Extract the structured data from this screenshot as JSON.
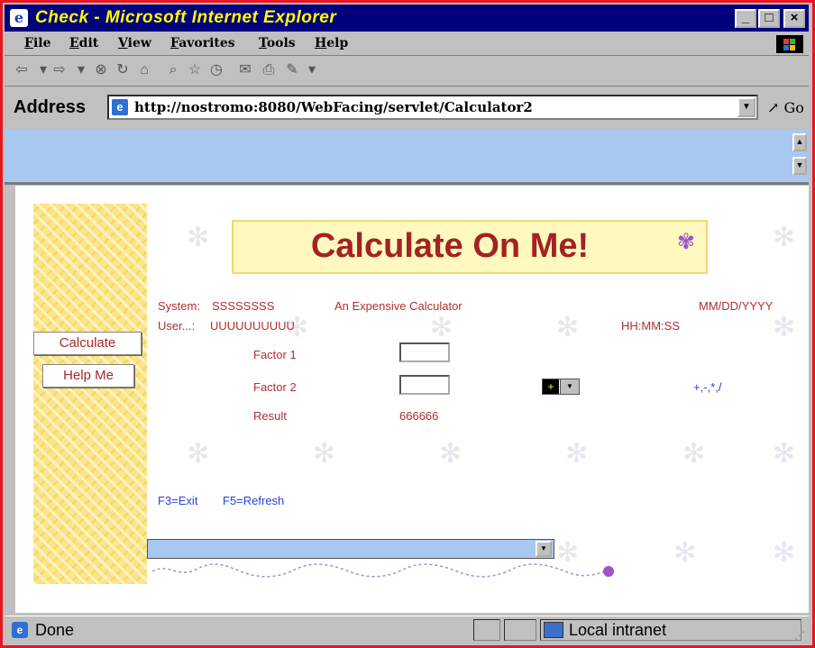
{
  "window": {
    "title": "Check - Microsoft Internet Explorer",
    "icon": "ie-icon",
    "buttons": {
      "minimize": "_",
      "maximize": "□",
      "close": "×"
    }
  },
  "menu": {
    "items": [
      "File",
      "Edit",
      "View",
      "Favorites",
      "Tools",
      "Help"
    ]
  },
  "toolbar": {
    "icons": [
      "back-icon",
      "forward-icon",
      "stop-icon",
      "refresh-icon",
      "home-icon",
      "search-icon",
      "favorites-icon",
      "history-icon",
      "mail-icon",
      "print-icon",
      "edit-icon"
    ]
  },
  "address": {
    "label": "Address",
    "url": "http://nostromo:8080/WebFacing/servlet/Calculator2",
    "go": "Go"
  },
  "sidebar": {
    "calculate": "Calculate",
    "help": "Help Me"
  },
  "banner": {
    "title": "Calculate On Me!"
  },
  "form": {
    "system_label": "System:",
    "system_value": "SSSSSSSS",
    "description": "An Expensive Calculator",
    "date_format": "MM/DD/YYYY",
    "user_label": "User...:",
    "user_value": "UUUUUUUUUU",
    "time_format": "HH:MM:SS",
    "factor1_label": "Factor 1",
    "factor1_value": "",
    "factor2_label": "Factor 2",
    "factor2_value": "",
    "operator_value": "+",
    "operators_hint": "+,-,*,/",
    "result_label": "Result",
    "result_value": "666666"
  },
  "function_keys": {
    "f3": "F3=Exit",
    "f5": "F5=Refresh"
  },
  "status": {
    "text": "Done",
    "zone": "Local intranet"
  },
  "colors": {
    "title_bar": "#00007c",
    "title_text": "#ffff00",
    "frame_border": "#e8141e",
    "top_frame": "#a8c8f0",
    "banner_text": "#a42222",
    "label_text": "#b03030",
    "link_text": "#2a3fd8"
  }
}
